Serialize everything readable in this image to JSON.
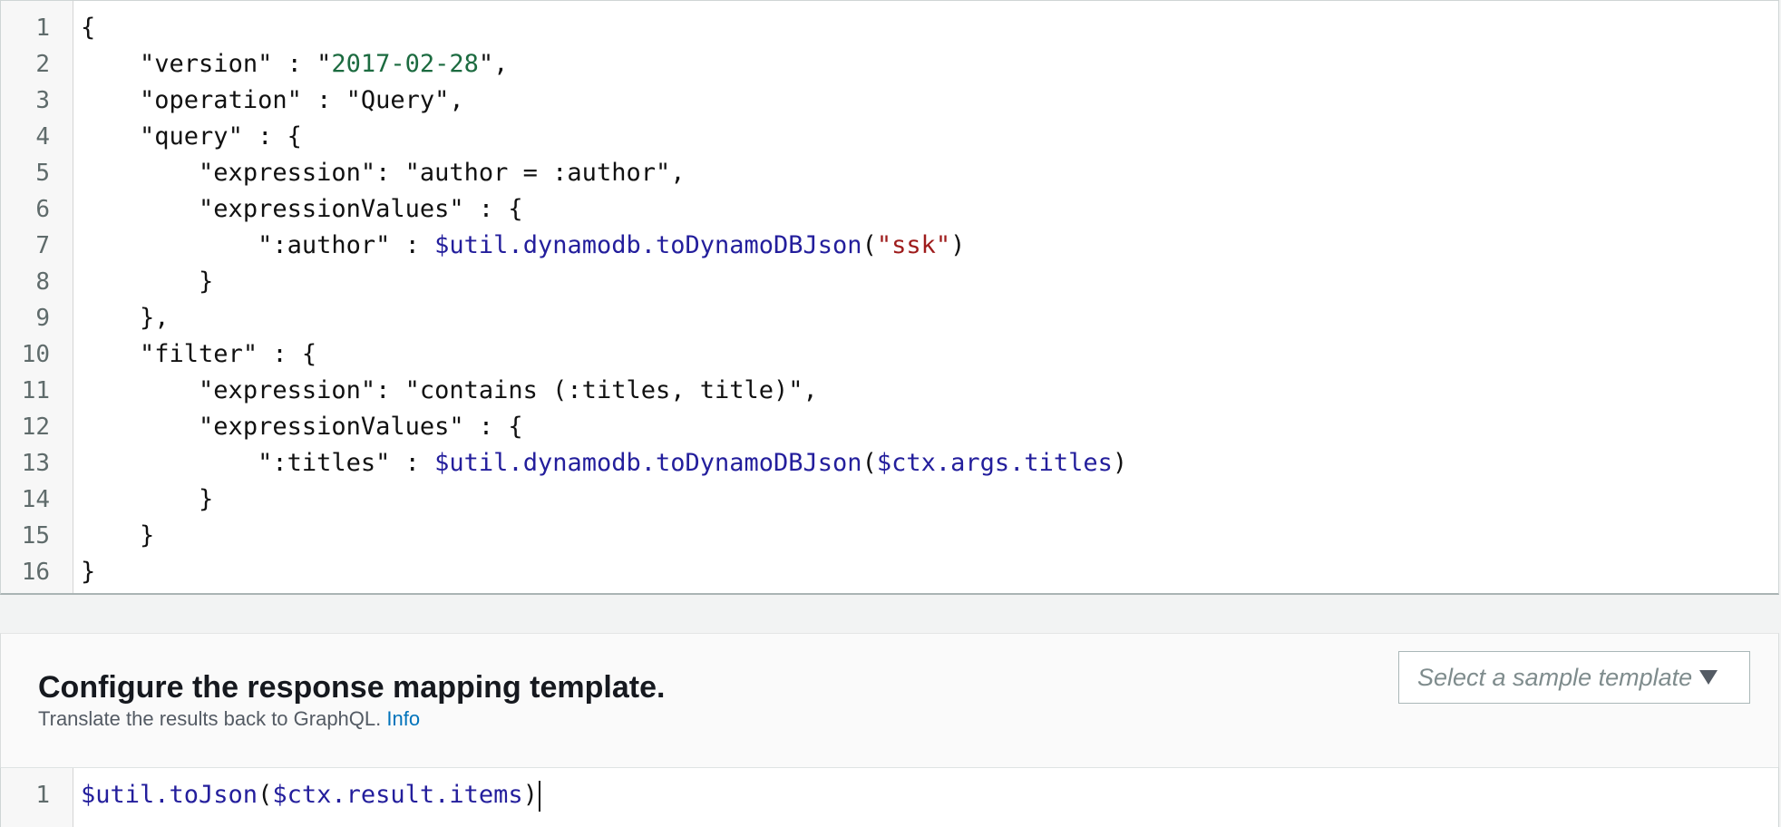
{
  "request_editor": {
    "lines": [
      {
        "n": "1",
        "indent": "",
        "tokens": [
          {
            "t": "{",
            "c": "plain"
          }
        ]
      },
      {
        "n": "2",
        "indent": "    ",
        "tokens": [
          {
            "t": "\"version\" : \"",
            "c": "plain"
          },
          {
            "t": "2017-02-28",
            "c": "green"
          },
          {
            "t": "\",",
            "c": "plain"
          }
        ]
      },
      {
        "n": "3",
        "indent": "    ",
        "tokens": [
          {
            "t": "\"operation\" : \"Query\",",
            "c": "plain"
          }
        ]
      },
      {
        "n": "4",
        "indent": "    ",
        "tokens": [
          {
            "t": "\"query\" : {",
            "c": "plain"
          }
        ]
      },
      {
        "n": "5",
        "indent": "        ",
        "tokens": [
          {
            "t": "\"expression\": \"author = :author\",",
            "c": "plain"
          }
        ]
      },
      {
        "n": "6",
        "indent": "        ",
        "tokens": [
          {
            "t": "\"expressionValues\" : {",
            "c": "plain"
          }
        ]
      },
      {
        "n": "7",
        "indent": "            ",
        "tokens": [
          {
            "t": "\":author\" : ",
            "c": "plain"
          },
          {
            "t": "$util.dynamodb.toDynamoDBJson",
            "c": "fn"
          },
          {
            "t": "(",
            "c": "plain"
          },
          {
            "t": "\"ssk\"",
            "c": "red"
          },
          {
            "t": ")",
            "c": "plain"
          }
        ]
      },
      {
        "n": "8",
        "indent": "        ",
        "tokens": [
          {
            "t": "}",
            "c": "plain"
          }
        ]
      },
      {
        "n": "9",
        "indent": "    ",
        "tokens": [
          {
            "t": "},",
            "c": "plain"
          }
        ]
      },
      {
        "n": "10",
        "indent": "    ",
        "tokens": [
          {
            "t": "\"filter\" : {",
            "c": "plain"
          }
        ]
      },
      {
        "n": "11",
        "indent": "        ",
        "tokens": [
          {
            "t": "\"expression\": \"contains (:titles, title)\",",
            "c": "plain"
          }
        ]
      },
      {
        "n": "12",
        "indent": "        ",
        "tokens": [
          {
            "t": "\"expressionValues\" : {",
            "c": "plain"
          }
        ]
      },
      {
        "n": "13",
        "indent": "            ",
        "tokens": [
          {
            "t": "\":titles\" : ",
            "c": "plain"
          },
          {
            "t": "$util.dynamodb.toDynamoDBJson",
            "c": "fn"
          },
          {
            "t": "(",
            "c": "plain"
          },
          {
            "t": "$ctx.args.titles",
            "c": "fn"
          },
          {
            "t": ")",
            "c": "plain"
          }
        ]
      },
      {
        "n": "14",
        "indent": "        ",
        "tokens": [
          {
            "t": "}",
            "c": "plain"
          }
        ]
      },
      {
        "n": "15",
        "indent": "    ",
        "tokens": [
          {
            "t": "}",
            "c": "plain"
          }
        ]
      },
      {
        "n": "16",
        "indent": "",
        "tokens": [
          {
            "t": "}",
            "c": "plain"
          }
        ]
      }
    ]
  },
  "response_section": {
    "title": "Configure the response mapping template.",
    "subtitle": "Translate the results back to GraphQL.",
    "info_link": "Info",
    "sample_select": {
      "placeholder": "Select a sample template",
      "icon": "caret-down-icon"
    }
  },
  "response_editor": {
    "lines": [
      {
        "n": "1",
        "indent": "",
        "tokens": [
          {
            "t": "$util.toJson",
            "c": "fn"
          },
          {
            "t": "(",
            "c": "plain"
          },
          {
            "t": "$ctx.result.items",
            "c": "fn"
          },
          {
            "t": ")",
            "c": "plain"
          }
        ]
      }
    ]
  },
  "colors": {
    "plain": "#111111",
    "green": "#1c6b40",
    "fn": "#231e9c",
    "red": "#9e1b1b",
    "link": "#0073bb"
  }
}
